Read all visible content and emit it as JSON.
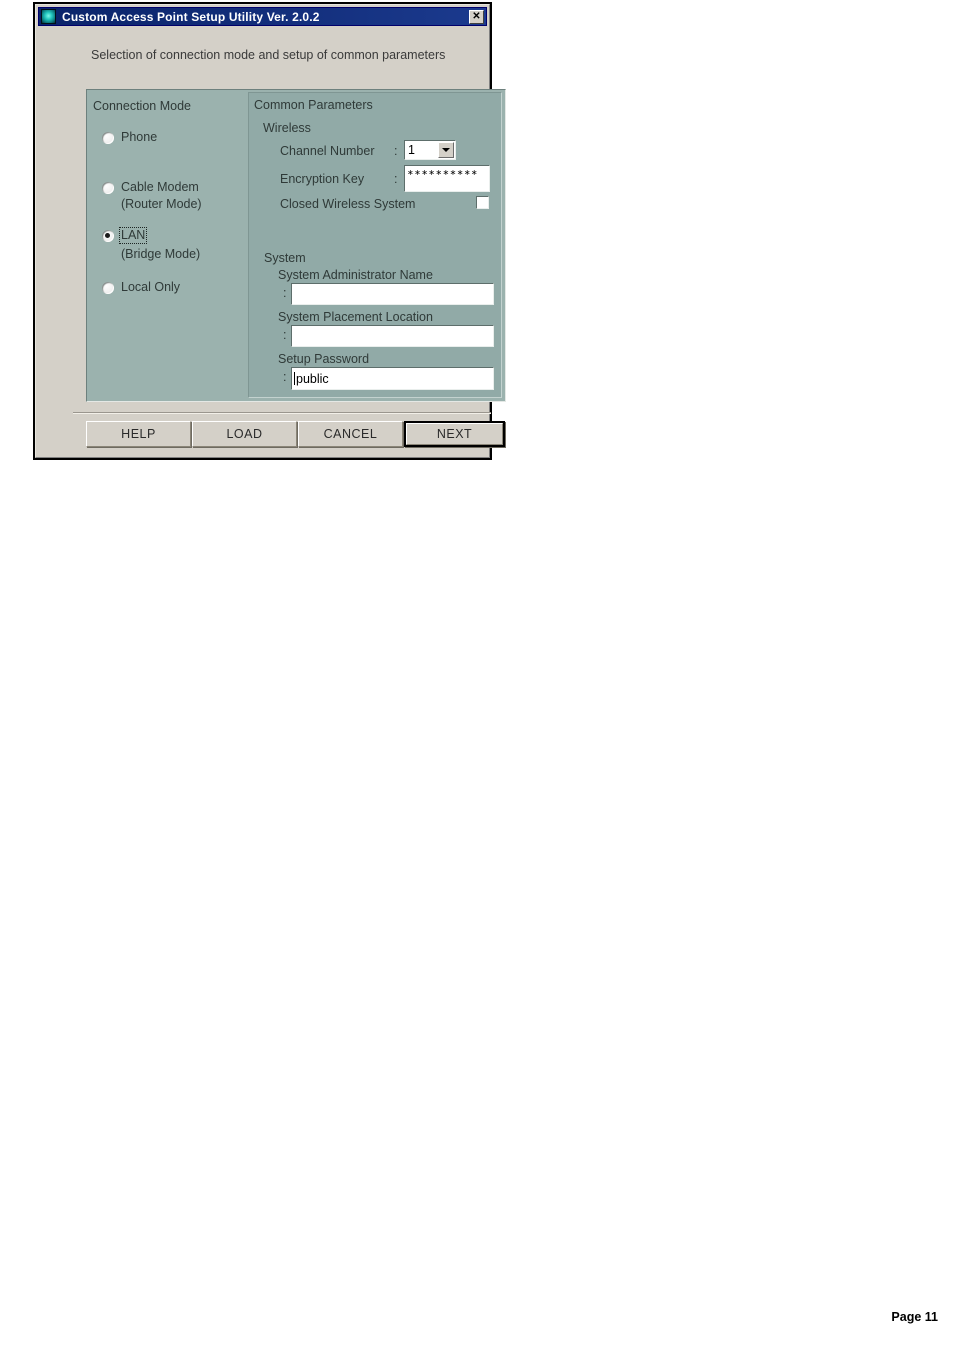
{
  "window": {
    "title": "Custom Access Point Setup Utility  Ver. 2.0.2",
    "icon": "access-point-icon",
    "close_label": "✕",
    "subtitle": "Selection of connection mode and setup of common parameters",
    "titlebar_color": "#0a246a",
    "panel_color": "#9bb2ae",
    "face_color": "#d4d0c8"
  },
  "connection_mode": {
    "group_label": "Connection Mode",
    "options": [
      {
        "label": "Phone",
        "sublabel": "",
        "selected": false,
        "focused": false
      },
      {
        "label": "Cable Modem",
        "sublabel": "(Router Mode)",
        "selected": false,
        "focused": false
      },
      {
        "label": "LAN",
        "sublabel": "(Bridge Mode)",
        "selected": true,
        "focused": true
      },
      {
        "label": "Local Only",
        "sublabel": "",
        "selected": false,
        "focused": false
      }
    ]
  },
  "common_parameters": {
    "group_label": "Common Parameters",
    "wireless": {
      "group_label": "Wireless",
      "channel_number": {
        "label": "Channel Number",
        "colon": ":",
        "value": "1",
        "arrow_icon": "chevron-down-icon"
      },
      "encryption_key": {
        "label": "Encryption Key",
        "colon": ":",
        "value": "∗∗∗∗∗∗∗∗∗∗",
        "placeholder": ""
      },
      "closed_wireless_system": {
        "label": "Closed Wireless System",
        "checked": false
      }
    },
    "system": {
      "group_label": "System",
      "administrator_name": {
        "label": "System Administrator Name",
        "colon": ":",
        "value": "",
        "placeholder": ""
      },
      "placement_location": {
        "label": "System Placement Location",
        "colon": ":",
        "value": "",
        "placeholder": ""
      },
      "setup_password": {
        "label": "Setup Password",
        "colon": ":",
        "value": "public",
        "placeholder": ""
      }
    }
  },
  "buttons": [
    {
      "label": "HELP",
      "is_default": false
    },
    {
      "label": "LOAD",
      "is_default": false
    },
    {
      "label": "CANCEL",
      "is_default": false
    },
    {
      "label": "NEXT",
      "is_default": true
    }
  ],
  "footer": {
    "page_label": "Page 11"
  }
}
